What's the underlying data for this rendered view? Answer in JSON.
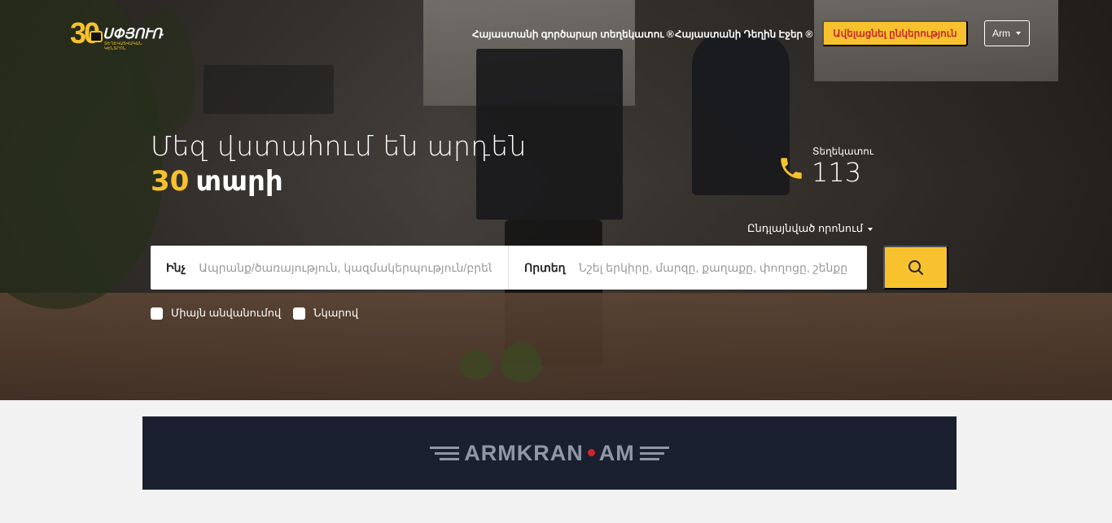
{
  "header": {
    "logo": {
      "number": "30",
      "brand": "ՍՓՅՈՒՌ",
      "subtitle": "ՏԵՂԵԿԱՏՎԱԿԱՆ ԿԵՆՏՐՈՆ"
    },
    "nav": [
      {
        "label": "Հայաստանի գործարար տեղեկատու ®"
      },
      {
        "label": "Հայաստանի Դեղին Էջեր ®"
      }
    ],
    "add_company_label": "Ավելացնել ընկերություն",
    "language": "Arm"
  },
  "hero": {
    "headline_line1": "Մեզ վստահում են արդեն",
    "years": "30",
    "years_word": "տարի",
    "phone_label": "Տեղեկատու",
    "phone_number": "113",
    "advanced_search_label": "Ընդլայնված որոնում"
  },
  "search": {
    "what_label": "Ինչ",
    "what_placeholder": "Ապրանք/ծառայություն, կազմակերպություն/բրեն",
    "where_label": "Որտեղ",
    "where_placeholder": "Նշել երկիրը, մարզը, քաղաքը, փողոցը, շենքը"
  },
  "filters": [
    {
      "label": "Միայն անվանումով",
      "checked": false
    },
    {
      "label": "Նկարով",
      "checked": false
    }
  ],
  "banner": {
    "text_left": "ARMKRAN",
    "text_right": "AM"
  },
  "colors": {
    "accent": "#f7c22d",
    "accent_text": "#c6282b",
    "banner_bg": "#1a2030"
  }
}
